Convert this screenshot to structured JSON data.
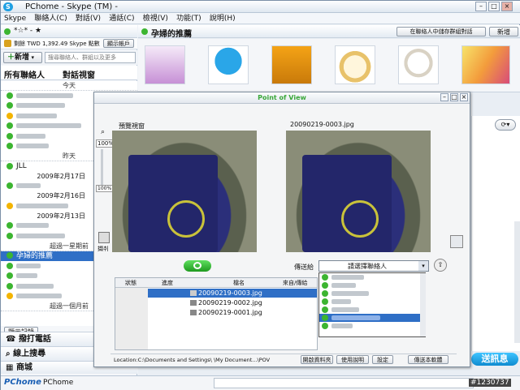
{
  "titlebar": {
    "title": "PChome - Skype (TM) -"
  },
  "menubar": {
    "items": [
      "Skype",
      "聯絡人(C)",
      "對話(V)",
      "通話(C)",
      "檢視(V)",
      "功能(T)",
      "說明(H)"
    ]
  },
  "profile": {
    "name": "*☆* - ★",
    "balance": "剩餘 TWD 1,392.49 Skype 點數",
    "show_account": "顯示帳戶"
  },
  "left": {
    "add_label": "新增",
    "search_placeholder": "搜尋聯絡人、群組以及更多",
    "tabs": [
      "所有聯絡人",
      "對話視窗"
    ],
    "today": "今天",
    "yesterday": "昨天",
    "contact_jll": "JLL",
    "date1": "2009年2月17日",
    "date2": "2009年2月16日",
    "date3": "2009年2月13日",
    "over_week": "超過一星期前",
    "selected_contact": "孕婦的推薦",
    "over_month": "超過一個月前",
    "show_history": "顯示記錄",
    "call_label": "撥打電話",
    "search_label": "線上搜尋",
    "shop_label": "商城",
    "pchome_label": "PChome"
  },
  "right": {
    "header_title": "孕婦的推薦",
    "save_group": "在聯絡人中儲存群組對話",
    "new_label": "新增",
    "send_label": "送訊息",
    "watermark": "#1230737"
  },
  "dialog": {
    "title": "Point of View",
    "preview_label": "預覽視窗",
    "zoom": "100%",
    "zoom_sub": "100%",
    "capture_label": "擷취",
    "file_label": "20090219-0003.jpg",
    "send_to_label": "傳送給",
    "select_placeholder": "請選擇聯絡人",
    "columns": [
      "狀態",
      "進度",
      "檔名",
      "來自/傳給"
    ],
    "files": [
      "20090219-0003.jpg",
      "20090219-0002.jpg",
      "20090219-0001.jpg"
    ],
    "location": "Location:C:\\Documents and Settings\\      \\My Document...\\POV",
    "buttons": [
      "開啟資料夾",
      "使用說明",
      "設定",
      "傳送本軟體"
    ]
  },
  "colors": {
    "accent": "#2f6fc6",
    "online": "#3cb531",
    "away": "#f3b400",
    "skype_blue": "#1fa0e3"
  }
}
